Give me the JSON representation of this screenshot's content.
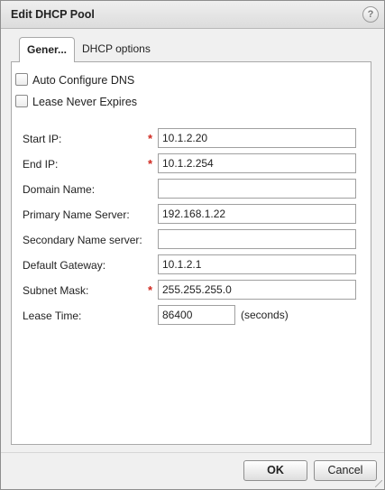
{
  "dialog": {
    "title": "Edit DHCP Pool",
    "help_icon": "question-mark-icon",
    "help_glyph": "?"
  },
  "tabs": [
    {
      "label": "Gener...",
      "active": true
    },
    {
      "label": "DHCP options",
      "active": false
    }
  ],
  "checkboxes": [
    {
      "label": "Auto Configure DNS",
      "checked": false
    },
    {
      "label": "Lease Never Expires",
      "checked": false
    }
  ],
  "fields": {
    "start_ip": {
      "label": "Start IP:",
      "value": "10.1.2.20",
      "required": true
    },
    "end_ip": {
      "label": "End IP:",
      "value": "10.1.2.254",
      "required": true
    },
    "domain_name": {
      "label": "Domain Name:",
      "value": "",
      "required": false
    },
    "primary_ns": {
      "label": "Primary Name Server:",
      "value": "192.168.1.22",
      "required": false
    },
    "secondary_ns": {
      "label": "Secondary Name server:",
      "value": "",
      "required": false
    },
    "default_gateway": {
      "label": "Default Gateway:",
      "value": "10.1.2.1",
      "required": false
    },
    "subnet_mask": {
      "label": "Subnet Mask:",
      "value": "255.255.255.0",
      "required": true
    },
    "lease_time": {
      "label": "Lease Time:",
      "value": "86400",
      "unit": "(seconds)",
      "required": false
    }
  },
  "required_marker": "*",
  "buttons": {
    "ok": "OK",
    "cancel": "Cancel"
  },
  "colors": {
    "required": "#d0281f",
    "title_bar": "#dcdcdc",
    "panel_bg": "#ffffff",
    "dialog_bg": "#f0f0f0"
  }
}
